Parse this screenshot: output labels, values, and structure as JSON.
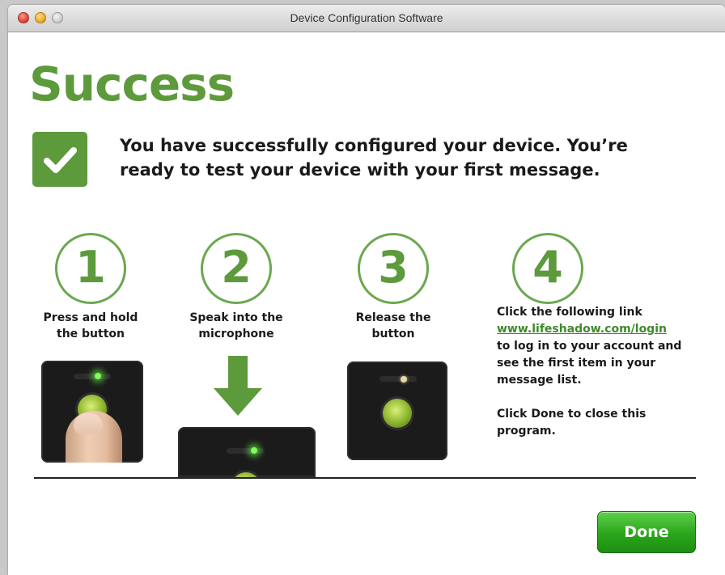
{
  "window": {
    "title": "Device Configuration Software"
  },
  "heading": "Success",
  "message": "You have successfully configured your device. You’re ready to test your device with your first message.",
  "steps": [
    {
      "number": "1",
      "label_line1": "Press and hold",
      "label_line2": "the button"
    },
    {
      "number": "2",
      "label_line1": "Speak into the",
      "label_line2": "microphone"
    },
    {
      "number": "3",
      "label_line1": "Release the",
      "label_line2": "button"
    },
    {
      "number": "4",
      "intro": "Click the following link",
      "link": "www.lifeshadow.com/login",
      "line3": "to log in to your account and",
      "line4": "see the first item in your",
      "line5": "message list.",
      "line6": "Click Done to close this",
      "line7": "program."
    }
  ],
  "done_label": "Done",
  "colors": {
    "brand_green": "#5d9a3b",
    "button_green": "#2aa51a",
    "link_green": "#3f8a2a"
  },
  "icons": [
    "checkmark-icon",
    "down-arrow-icon"
  ]
}
